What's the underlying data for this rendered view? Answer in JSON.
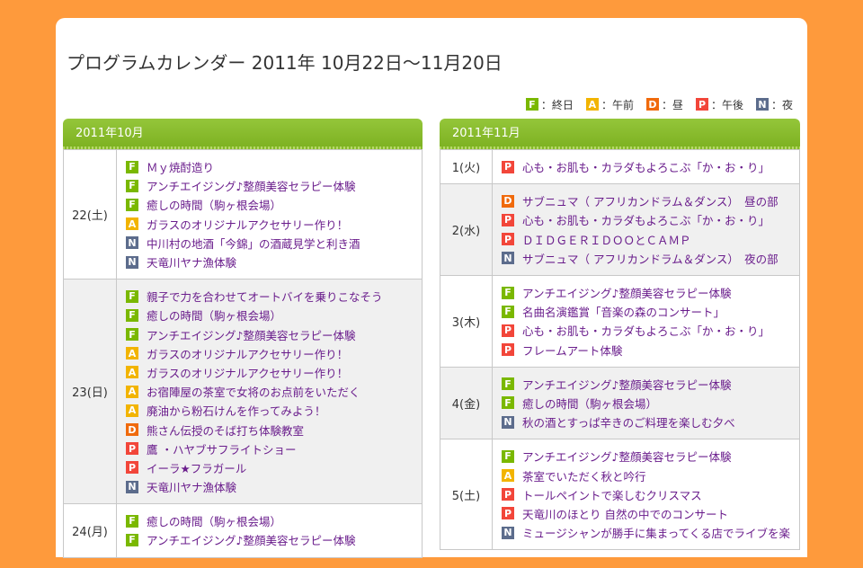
{
  "page": {
    "title": "プログラムカレンダー 2011年 10月22日〜11月20日"
  },
  "legend": [
    {
      "code": "F",
      "label": "：終日"
    },
    {
      "code": "A",
      "label": "：午前"
    },
    {
      "code": "D",
      "label": "：昼"
    },
    {
      "code": "P",
      "label": "：午後"
    },
    {
      "code": "N",
      "label": "：夜"
    }
  ],
  "months": [
    {
      "name": "2011年10月",
      "days": [
        {
          "day": "22(土)",
          "events": [
            {
              "code": "F",
              "title": "Ｍｙ焼酎造り"
            },
            {
              "code": "F",
              "title": "アンチエイジング♪整顔美容セラピー体験"
            },
            {
              "code": "F",
              "title": "癒しの時間（駒ヶ根会場）"
            },
            {
              "code": "A",
              "title": "ガラスのオリジナルアクセサリー作り！"
            },
            {
              "code": "N",
              "title": "中川村の地酒「今錦」の酒蔵見学と利き酒"
            },
            {
              "code": "N",
              "title": "天竜川ヤナ漁体験"
            }
          ]
        },
        {
          "day": "23(日)",
          "events": [
            {
              "code": "F",
              "title": "親子で力を合わせてオートバイを乗りこなそう"
            },
            {
              "code": "F",
              "title": "癒しの時間（駒ヶ根会場）"
            },
            {
              "code": "F",
              "title": "アンチエイジング♪整顔美容セラピー体験"
            },
            {
              "code": "A",
              "title": "ガラスのオリジナルアクセサリー作り！"
            },
            {
              "code": "A",
              "title": "ガラスのオリジナルアクセサリー作り！"
            },
            {
              "code": "A",
              "title": "お宿陣屋の茶室で女将のお点前をいただく"
            },
            {
              "code": "A",
              "title": "廃油から粉石けんを作ってみよう！"
            },
            {
              "code": "D",
              "title": "熊さん伝授のそば打ち体験教室"
            },
            {
              "code": "P",
              "title": "鷹 ・ハヤブサフライトショー"
            },
            {
              "code": "P",
              "title": "イーラ★フラガール"
            },
            {
              "code": "N",
              "title": "天竜川ヤナ漁体験"
            }
          ]
        },
        {
          "day": "24(月)",
          "events": [
            {
              "code": "F",
              "title": "癒しの時間（駒ヶ根会場）"
            },
            {
              "code": "F",
              "title": "アンチエイジング♪整顔美容セラピー体験"
            }
          ]
        }
      ]
    },
    {
      "name": "2011年11月",
      "days": [
        {
          "day": "1(火)",
          "events": [
            {
              "code": "P",
              "title": "心も・お肌も・カラダもよろこぶ「か・お・り」"
            }
          ]
        },
        {
          "day": "2(水)",
          "events": [
            {
              "code": "D",
              "title": "サブニュマ（ アフリカンドラム＆ダンス）　昼の部"
            },
            {
              "code": "P",
              "title": "心も・お肌も・カラダもよろこぶ「か・お・り」"
            },
            {
              "code": "P",
              "title": "ＤＩＤＧＥＲＩＤＯＯとＣＡＭＰ"
            },
            {
              "code": "N",
              "title": "サブニュマ（ アフリカンドラム＆ダンス）　夜の部"
            }
          ]
        },
        {
          "day": "3(木)",
          "events": [
            {
              "code": "F",
              "title": "アンチエイジング♪整顔美容セラピー体験"
            },
            {
              "code": "F",
              "title": "名曲名演鑑賞「音楽の森のコンサート」"
            },
            {
              "code": "P",
              "title": "心も・お肌も・カラダもよろこぶ「か・お・り」"
            },
            {
              "code": "P",
              "title": "フレームアート体験"
            }
          ]
        },
        {
          "day": "4(金)",
          "events": [
            {
              "code": "F",
              "title": "アンチエイジング♪整顔美容セラピー体験"
            },
            {
              "code": "F",
              "title": "癒しの時間（駒ヶ根会場）"
            },
            {
              "code": "N",
              "title": "秋の酒とすっぱ辛きのご料理を楽しむ夕べ"
            }
          ]
        },
        {
          "day": "5(土)",
          "events": [
            {
              "code": "F",
              "title": "アンチエイジング♪整顔美容セラピー体験"
            },
            {
              "code": "A",
              "title": "茶室でいただく秋と吟行"
            },
            {
              "code": "P",
              "title": "トールペイントで楽しむクリスマス"
            },
            {
              "code": "P",
              "title": "天竜川のほとり 自然の中でのコンサート"
            },
            {
              "code": "N",
              "title": "ミュージシャンが勝手に集まってくる店でライブを楽"
            }
          ]
        }
      ]
    }
  ],
  "colors": {
    "background": "#fe9a3c",
    "header_green": "#86bb2a",
    "badge_F": "#7ab800",
    "badge_A": "#f2b400",
    "badge_D": "#f06a0c",
    "badge_P": "#f2463a",
    "badge_N": "#5c6c8c"
  }
}
